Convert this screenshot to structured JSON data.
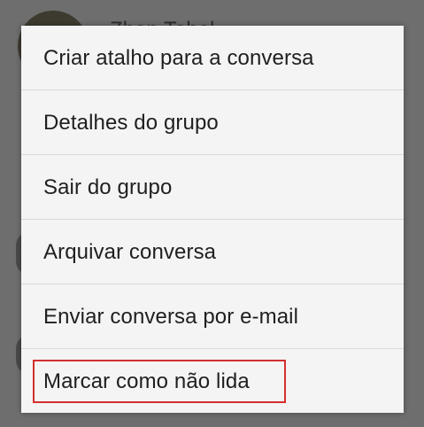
{
  "background": {
    "chat_title": "Zhan Tahal..."
  },
  "context_menu": {
    "items": [
      {
        "label": "Criar atalho para a conversa"
      },
      {
        "label": "Detalhes do grupo"
      },
      {
        "label": "Sair do grupo"
      },
      {
        "label": "Arquivar conversa"
      },
      {
        "label": "Enviar conversa por e-mail"
      },
      {
        "label": "Marcar como não lida"
      }
    ],
    "highlighted_item": "Marcar como não lida",
    "highlight_color": "#d32f2f"
  }
}
